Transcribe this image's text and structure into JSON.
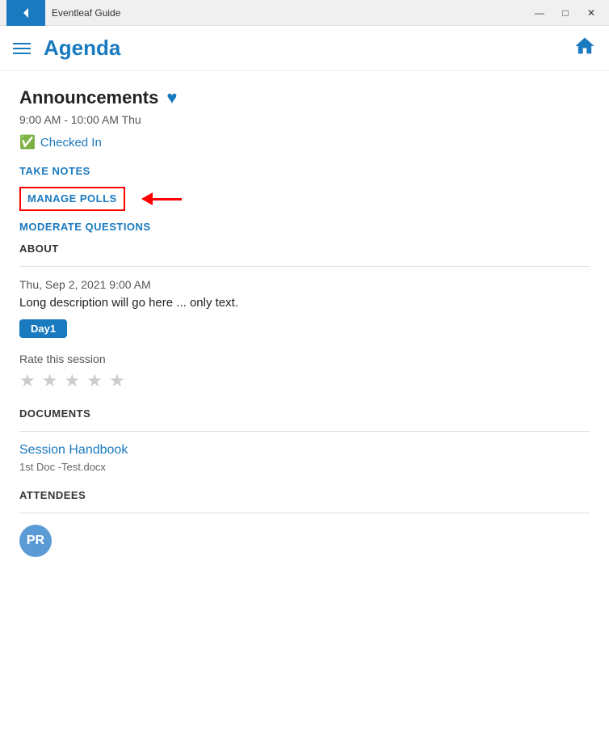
{
  "titlebar": {
    "back_label": "←",
    "app_name": "Eventleaf Guide",
    "minimize": "—",
    "maximize": "□",
    "close": "✕"
  },
  "header": {
    "title": "Agenda",
    "hamburger_label": "Menu",
    "home_label": "Home"
  },
  "session": {
    "title": "Announcements",
    "time": "9:00 AM - 10:00 AM  Thu",
    "checked_in_label": "Checked In",
    "take_notes_label": "TAKE NOTES",
    "manage_polls_label": "MANAGE POLLS",
    "moderate_questions_label": "MODERATE QUESTIONS"
  },
  "about": {
    "heading": "ABOUT",
    "date": "Thu, Sep 2, 2021 9:00 AM",
    "description": "Long description will go here ... only text.",
    "day_badge": "Day1",
    "rate_label": "Rate this session",
    "stars": [
      "★",
      "★",
      "★",
      "★",
      "★"
    ]
  },
  "documents": {
    "heading": "DOCUMENTS",
    "items": [
      {
        "name": "Session Handbook",
        "filename": "1st Doc -Test.docx"
      }
    ]
  },
  "attendees": {
    "heading": "ATTENDEES",
    "initials": "PR"
  },
  "annotation": {
    "arrow_label": "arrow pointing to manage polls"
  }
}
